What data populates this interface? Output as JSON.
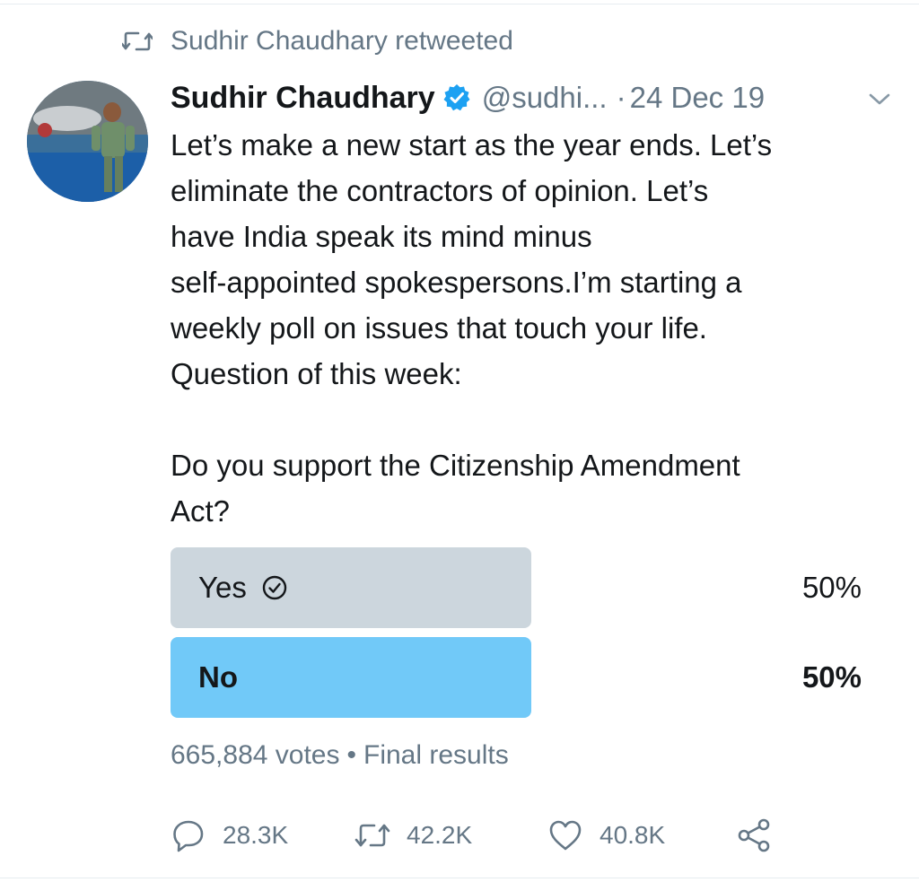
{
  "retweet_context": {
    "text": "Sudhir Chaudhary retweeted",
    "icon": "retweet-icon"
  },
  "tweet": {
    "author_name": "Sudhir Chaudhary",
    "verified": true,
    "handle": "@sudhi...",
    "separator": "·",
    "date": "24 Dec 19",
    "body_lines": [
      "Let’s make a new start as the year ends. Let’s",
      "eliminate the contractors of opinion. Let’s",
      "have India speak its mind minus",
      "self-appointed spokespersons.I’m starting a",
      "weekly poll on issues that touch your life.",
      "Question of this week:",
      "",
      "Do you support the Citizenship Amendment",
      "Act?"
    ]
  },
  "poll": {
    "options": [
      {
        "label": "Yes",
        "percent_text": "50%",
        "share": 0.5,
        "voted": true,
        "leading": false,
        "color": "#ccd6dd"
      },
      {
        "label": "No",
        "percent_text": "50%",
        "share": 0.5,
        "voted": false,
        "leading": true,
        "color": "#71c9f8"
      }
    ],
    "votes": "665,884 votes",
    "meta_separator": "•",
    "status": "Final results"
  },
  "actions": {
    "replies": "28.3K",
    "retweets": "42.2K",
    "likes": "40.8K"
  },
  "colors": {
    "text": "#14171a",
    "secondary": "#657786",
    "verified_blue": "#1da1f2",
    "divider": "#e6ecf0"
  }
}
